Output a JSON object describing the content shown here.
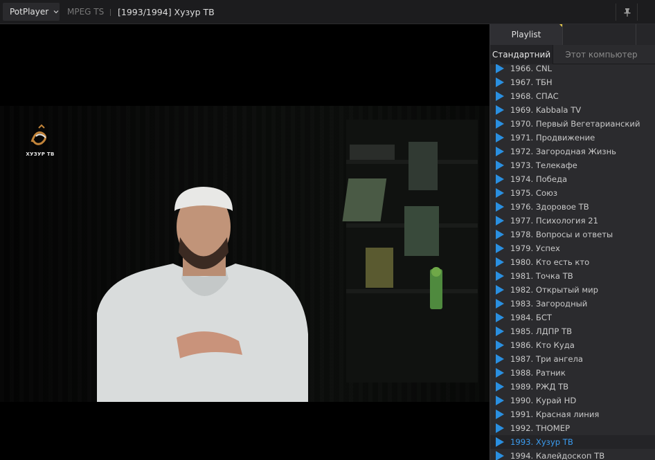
{
  "titlebar": {
    "app_name": "PotPlayer",
    "format": "MPEG TS",
    "title": "[1993/1994] Хузур ТВ"
  },
  "video": {
    "logo_text": "ХУЗУР ТВ"
  },
  "playlist": {
    "tab_label": "Playlist",
    "subtabs": [
      "Стандартний",
      "Этот компьютер"
    ],
    "active_index": 27,
    "items": [
      "1966. CNL",
      "1967. ТБН",
      "1968. СПАС",
      "1969. Kabbala TV",
      "1970. Первый Вегетарианский",
      "1971. Продвижение",
      "1972. Загородная Жизнь",
      "1973. Телекафе",
      "1974. Победа",
      "1975. Союз",
      "1976. Здоровое ТВ",
      "1977. Психология 21",
      "1978. Вопросы и ответы",
      "1979. Успех",
      "1980. Кто есть кто",
      "1981. Точка ТВ",
      "1982. Открытый мир",
      "1983. Загородный",
      "1984. БСТ",
      "1985. ЛДПР ТВ",
      "1986. Кто Куда",
      "1987. Три ангела",
      "1988. Ратник",
      "1989. РЖД ТВ",
      "1990. Курай HD",
      "1991. Красная линия",
      "1992. ТНОМЕР",
      "1993. Хузур ТВ",
      "1994. Калейдоскоп ТВ"
    ]
  },
  "colors": {
    "accent": "#3b9cf0",
    "play_icon": "#2a8fe0",
    "tab_marker": "#e6c84a"
  }
}
